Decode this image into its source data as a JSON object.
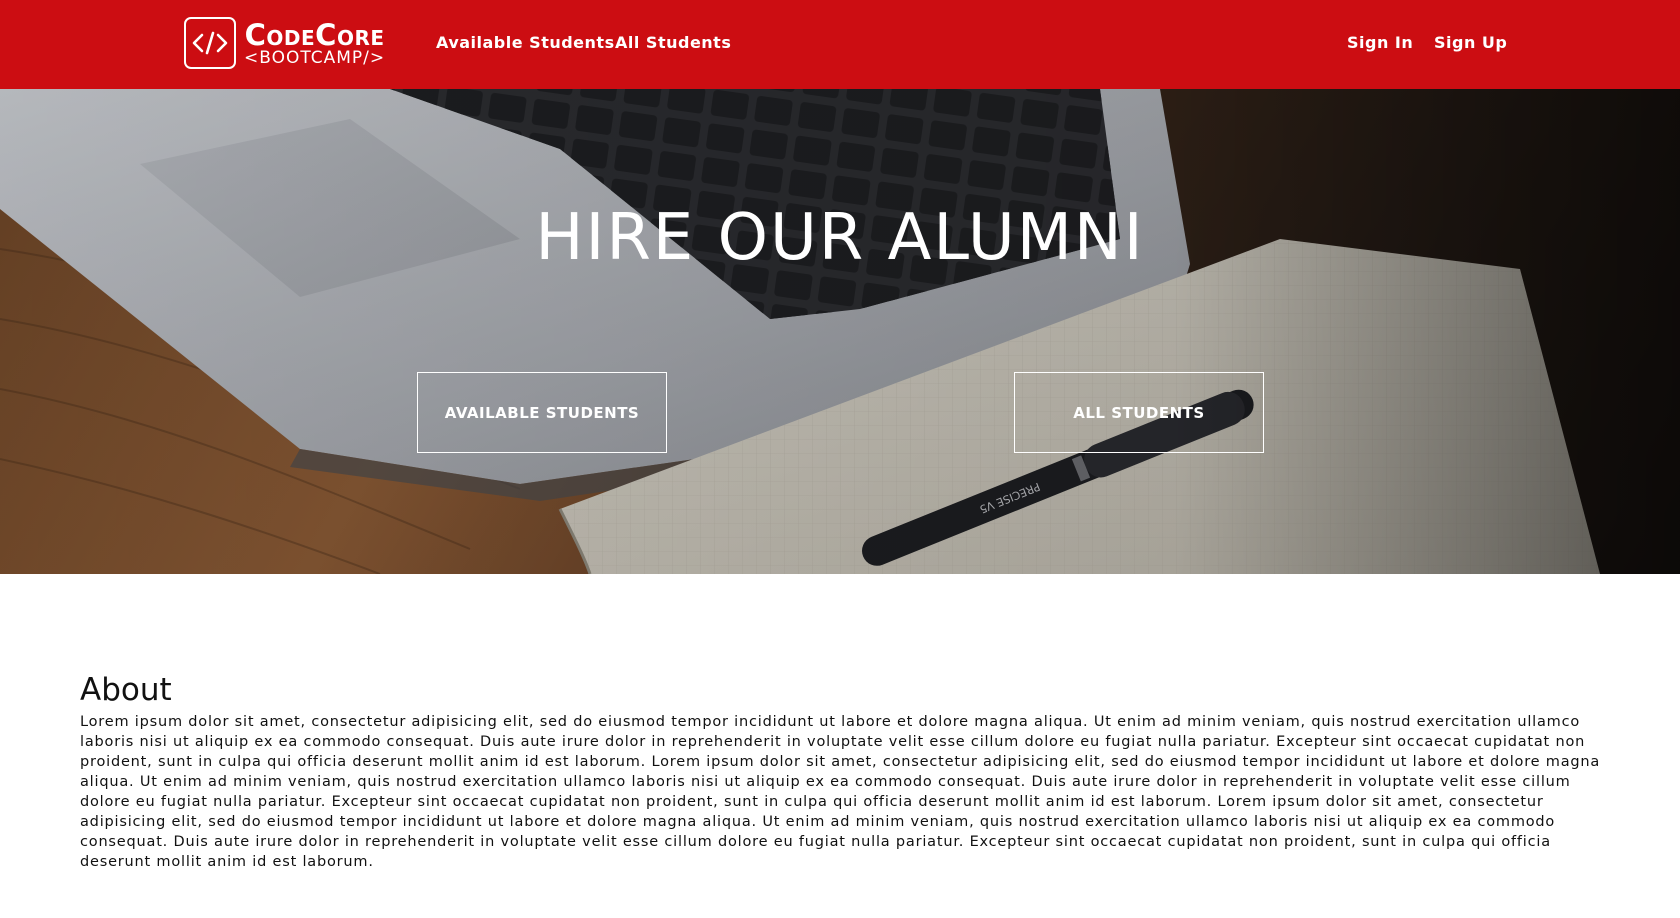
{
  "colors": {
    "navbar_bg": "#cc0d12",
    "nav_text": "#ffffff",
    "hero_text": "#ffffff"
  },
  "navbar": {
    "logo": {
      "icon": "code-brackets-icon",
      "main": "CodeCore",
      "sub": "<BOOTCAMP/>"
    },
    "links": {
      "available_students": "Available Students",
      "all_students": "All Students",
      "sign_in": "Sign In",
      "sign_up": "Sign Up"
    }
  },
  "hero": {
    "title": "HIRE OUR ALUMNI",
    "buttons": {
      "available_students": "AVAILABLE STUDENTS",
      "all_students": "ALL STUDENTS"
    }
  },
  "about": {
    "title": "About",
    "body": "Lorem ipsum dolor sit amet, consectetur adipisicing elit, sed do eiusmod tempor incididunt ut labore et dolore magna aliqua. Ut enim ad minim veniam, quis nostrud exercitation ullamco laboris nisi ut aliquip ex ea commodo consequat. Duis aute irure dolor in reprehenderit in voluptate velit esse cillum dolore eu fugiat nulla pariatur. Excepteur sint occaecat cupidatat non proident, sunt in culpa qui officia deserunt mollit anim id est laborum. Lorem ipsum dolor sit amet, consectetur adipisicing elit, sed do eiusmod tempor incididunt ut labore et dolore magna aliqua. Ut enim ad minim veniam, quis nostrud exercitation ullamco laboris nisi ut aliquip ex ea commodo consequat. Duis aute irure dolor in reprehenderit in voluptate velit esse cillum dolore eu fugiat nulla pariatur. Excepteur sint occaecat cupidatat non proident, sunt in culpa qui officia deserunt mollit anim id est laborum. Lorem ipsum dolor sit amet, consectetur adipisicing elit, sed do eiusmod tempor incididunt ut labore et dolore magna aliqua. Ut enim ad minim veniam, quis nostrud exercitation ullamco laboris nisi ut aliquip ex ea commodo consequat. Duis aute irure dolor in reprehenderit in voluptate velit esse cillum dolore eu fugiat nulla pariatur. Excepteur sint occaecat cupidatat non proident, sunt in culpa qui officia deserunt mollit anim id est laborum."
  }
}
